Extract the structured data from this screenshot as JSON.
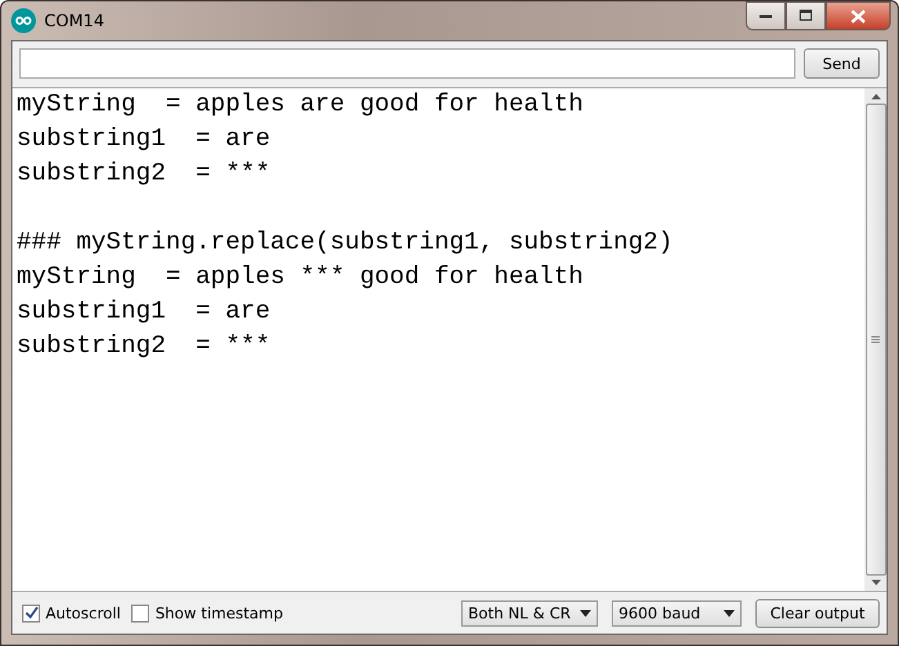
{
  "window": {
    "title": "COM14"
  },
  "send_button": "Send",
  "output_blocks": [
    {
      "lines": [
        "myString  = apples are good for health",
        "substring1  = are",
        "substring2  = ***"
      ]
    },
    {
      "lines": [
        "### myString.replace(substring1, substring2)",
        "myString  = apples *** good for health",
        "substring1  = are",
        "substring2  = ***"
      ]
    }
  ],
  "options": [
    {
      "label": "Autoscroll",
      "checked": true
    },
    {
      "label": "Show timestamp",
      "checked": false
    }
  ],
  "line_ending": "Both NL & CR",
  "baud": "9600 baud",
  "clear_button": "Clear output"
}
